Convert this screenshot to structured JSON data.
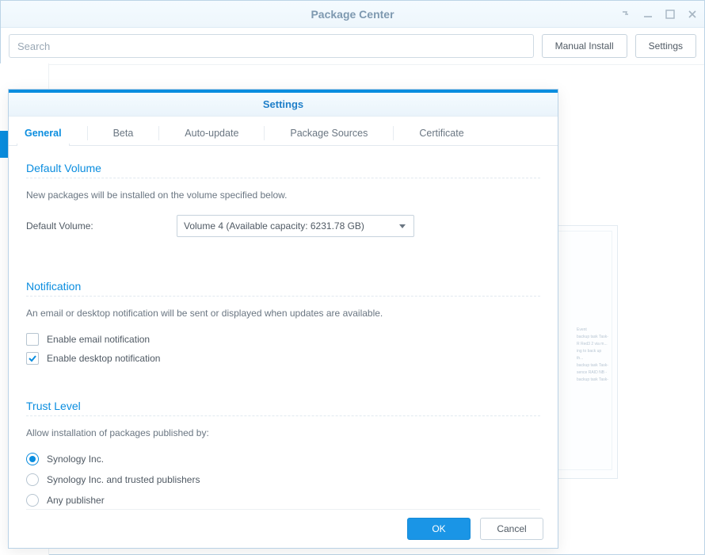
{
  "window": {
    "title": "Package Center"
  },
  "toolbar": {
    "search_placeholder": "Search",
    "manual_install": "Manual Install",
    "settings": "Settings"
  },
  "modal": {
    "title": "Settings",
    "tabs": {
      "general": "General",
      "beta": "Beta",
      "auto_update": "Auto-update",
      "package_sources": "Package Sources",
      "certificate": "Certificate"
    },
    "default_volume": {
      "heading": "Default Volume",
      "desc": "New packages will be installed on the volume specified below.",
      "label": "Default Volume:",
      "value": "Volume 4 (Available capacity: 6231.78 GB)"
    },
    "notification": {
      "heading": "Notification",
      "desc": "An email or desktop notification will be sent or displayed when updates are available.",
      "email": "Enable email notification",
      "desktop": "Enable desktop notification"
    },
    "trust": {
      "heading": "Trust Level",
      "desc": "Allow installation of packages published by:",
      "opt1": "Synology Inc.",
      "opt2": "Synology Inc. and trusted publishers",
      "opt3": "Any publisher"
    },
    "buttons": {
      "ok": "OK",
      "cancel": "Cancel"
    }
  }
}
